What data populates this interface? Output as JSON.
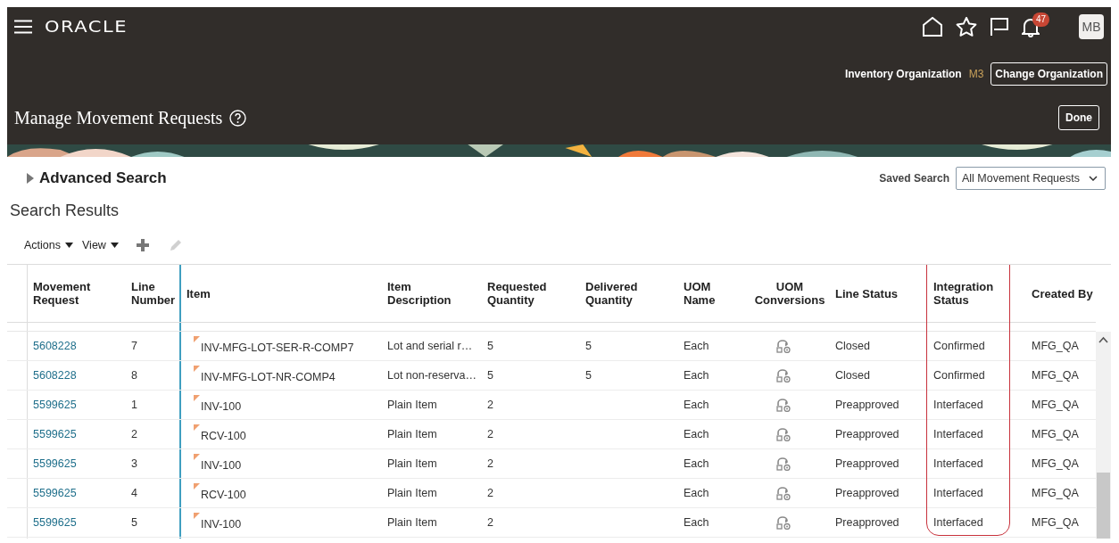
{
  "header": {
    "brand": "ORACLE",
    "notifications": "47",
    "avatar": "MB",
    "org_label": "Inventory Organization",
    "org_value": "M3",
    "change_org": "Change Organization",
    "page_title": "Manage Movement Requests",
    "done": "Done"
  },
  "search": {
    "advanced": "Advanced Search",
    "expanded": false,
    "saved_label": "Saved Search",
    "saved_value": "All Movement Requests"
  },
  "results": {
    "title": "Search Results",
    "menus": [
      "Actions",
      "View"
    ],
    "edit_disabled": true,
    "columns": [
      {
        "label": "Movement Request",
        "highlighted": false
      },
      {
        "label": "Line Number",
        "highlighted": false
      },
      {
        "label": "Item",
        "highlighted": false
      },
      {
        "label": "Item Description",
        "highlighted": false
      },
      {
        "label": "Requested Quantity",
        "highlighted": false
      },
      {
        "label": "Delivered Quantity",
        "highlighted": false
      },
      {
        "label": "UOM Name",
        "highlighted": false
      },
      {
        "label": "UOM Conversions",
        "highlighted": false
      },
      {
        "label": "Line Status",
        "highlighted": false
      },
      {
        "label": "Integration Status",
        "highlighted": true
      },
      {
        "label": "Created By",
        "highlighted": false
      }
    ],
    "rows": [
      {
        "request": "5608228",
        "line": "7",
        "item": "INV-MFG-LOT-SER-R-COMP7",
        "flagged": true,
        "description": "Lot and serial r…",
        "requested": "5",
        "delivered": "5",
        "uom": "Each",
        "line_status": "Closed",
        "integration_status": "Confirmed",
        "created_by": "MFG_QA"
      },
      {
        "request": "5608228",
        "line": "8",
        "item": "INV-MFG-LOT-NR-COMP4",
        "flagged": true,
        "description": "Lot non-reserva…",
        "requested": "5",
        "delivered": "5",
        "uom": "Each",
        "line_status": "Closed",
        "integration_status": "Confirmed",
        "created_by": "MFG_QA"
      },
      {
        "request": "5599625",
        "line": "1",
        "item": "INV-100",
        "flagged": true,
        "description": "Plain Item",
        "requested": "2",
        "uom": "Each",
        "line_status": "Preapproved",
        "integration_status": "Interfaced",
        "created_by": "MFG_QA"
      },
      {
        "request": "5599625",
        "line": "2",
        "item": "RCV-100",
        "flagged": true,
        "description": "Plain Item",
        "requested": "2",
        "uom": "Each",
        "line_status": "Preapproved",
        "integration_status": "Interfaced",
        "created_by": "MFG_QA"
      },
      {
        "request": "5599625",
        "line": "3",
        "item": "INV-100",
        "flagged": true,
        "description": "Plain Item",
        "requested": "2",
        "uom": "Each",
        "line_status": "Preapproved",
        "integration_status": "Interfaced",
        "created_by": "MFG_QA"
      },
      {
        "request": "5599625",
        "line": "4",
        "item": "RCV-100",
        "flagged": true,
        "description": "Plain Item",
        "requested": "2",
        "uom": "Each",
        "line_status": "Preapproved",
        "integration_status": "Interfaced",
        "created_by": "MFG_QA"
      },
      {
        "request": "5599625",
        "line": "5",
        "item": "INV-100",
        "flagged": true,
        "description": "Plain Item",
        "requested": "2",
        "uom": "Each",
        "line_status": "Preapproved",
        "integration_status": "Interfaced",
        "created_by": "MFG_QA"
      }
    ]
  }
}
